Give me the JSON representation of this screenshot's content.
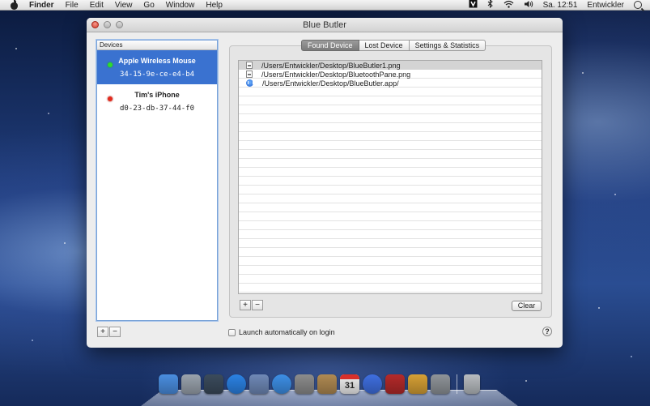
{
  "menubar": {
    "app": "Finder",
    "items": [
      "File",
      "Edit",
      "View",
      "Go",
      "Window",
      "Help"
    ],
    "clock": "Sa. 12:51",
    "user": "Entwickler"
  },
  "window": {
    "title": "Blue Butler",
    "devices_header": "Devices",
    "devices": [
      {
        "name": "Apple Wireless Mouse",
        "address": "34-15-9e-ce-e4-b4",
        "status": "connected",
        "status_color": "#2edc2a"
      },
      {
        "name": "Tim's iPhone",
        "address": "d0-23-db-37-44-f0",
        "status": "disconnected",
        "status_color": "#e32b1e"
      }
    ],
    "add_label": "+",
    "remove_label": "−",
    "tabs": [
      {
        "label": "Found Device",
        "active": true
      },
      {
        "label": "Lost Device",
        "active": false
      },
      {
        "label": "Settings & Statistics",
        "active": false
      }
    ],
    "files": [
      {
        "path": "/Users/Entwickler/Desktop/BlueButler1.png",
        "icon": "png-file-icon"
      },
      {
        "path": "/Users/Entwickler/Desktop/BluetoothPane.png",
        "icon": "png-file-icon"
      },
      {
        "path": "/Users/Entwickler/Desktop/BlueButler.app/",
        "icon": "app-icon"
      }
    ],
    "clear_label": "Clear",
    "launch_label": "Launch automatically on login",
    "launch_checked": false,
    "help_label": "?"
  },
  "dock": {
    "icons": [
      {
        "name": "finder-icon",
        "color": "#4a8ee0"
      },
      {
        "name": "launchpad-icon",
        "color": "#9aa3ad"
      },
      {
        "name": "mission-control-icon",
        "color": "#3b4b5c"
      },
      {
        "name": "app-store-icon",
        "color": "#2b82e4"
      },
      {
        "name": "preview-icon",
        "color": "#6f89b7"
      },
      {
        "name": "safari-icon",
        "color": "#3d8fe6"
      },
      {
        "name": "facetime-icon",
        "color": "#8c8c8c"
      },
      {
        "name": "address-book-icon",
        "color": "#b08a52"
      },
      {
        "name": "calendar-icon",
        "color": "#f2f2f2"
      },
      {
        "name": "itunes-icon",
        "color": "#3f6fe0"
      },
      {
        "name": "photo-booth-icon",
        "color": "#b42a2a"
      },
      {
        "name": "iphoto-icon",
        "color": "#d6a035"
      },
      {
        "name": "system-preferences-icon",
        "color": "#8f9499"
      },
      {
        "name": "trash-icon",
        "color": "#b8bcc0"
      }
    ],
    "calendar_day": "31"
  }
}
